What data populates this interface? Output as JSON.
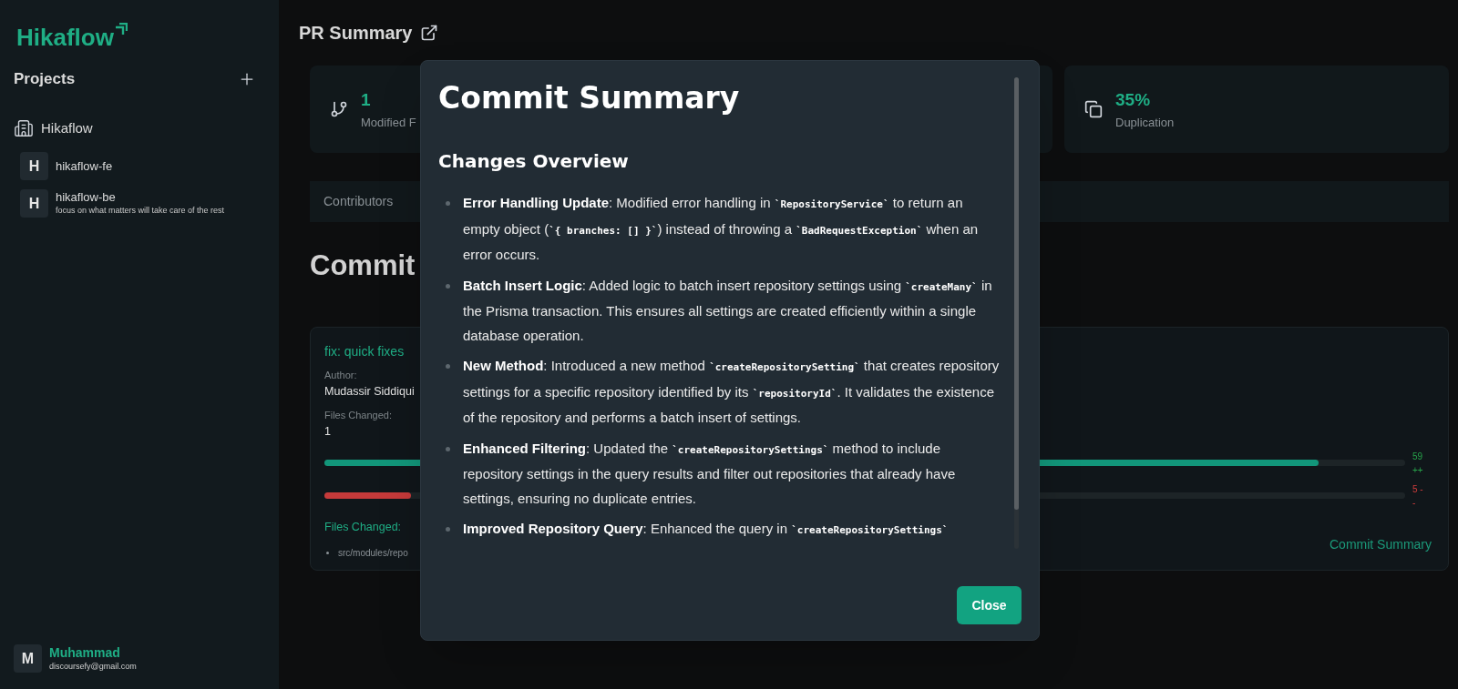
{
  "sidebar": {
    "logo": "Hikaflow",
    "projects_title": "Projects",
    "group": {
      "name": "Hikaflow",
      "repos": [
        {
          "avatar": "H",
          "name": "hikaflow-fe"
        },
        {
          "avatar": "H",
          "name": "hikaflow-be",
          "description": "focus on what matters will take care of the rest"
        }
      ]
    },
    "user": {
      "avatar": "M",
      "name": "Muhammad",
      "email": "discoursefy@gmail.com"
    }
  },
  "main": {
    "title": "PR Summary",
    "stats": [
      {
        "kind": "branch",
        "value": "1",
        "label": "Modified F"
      },
      {
        "kind": "copy",
        "value": "35%",
        "label": "Duplication"
      }
    ],
    "tabs": [
      {
        "label": "Contributors"
      }
    ],
    "section_heading": "Commit",
    "commit": {
      "title": "fix: quick fixes",
      "author_label": "Author:",
      "author": "Mudassir Siddiqui",
      "files_label": "Files Changed:",
      "files_count": "1",
      "changes": [
        {
          "kind": "additions",
          "level": 0.92,
          "reading": [
            "59",
            "++"
          ]
        },
        {
          "kind": "deletions",
          "level": 0.08,
          "reading": [
            "5 -",
            "-"
          ]
        }
      ],
      "files_heading": "Files Changed:",
      "files": [
        "src/modules/repo"
      ],
      "link": "Commit Summary"
    }
  },
  "modal": {
    "title": "Commit Summary",
    "heading": "Changes Overview",
    "items": [
      [
        {
          "kind": "bold",
          "text": "Error Handling Update"
        },
        {
          "kind": "text",
          "text": ": Modified error handling in "
        },
        {
          "kind": "code",
          "text": "`RepositoryService`"
        },
        {
          "kind": "text",
          "text": " to return an empty object ("
        },
        {
          "kind": "code",
          "text": "`{ branches: [] }`"
        },
        {
          "kind": "text",
          "text": ") instead of throwing a "
        },
        {
          "kind": "code",
          "text": "`BadRequestException`"
        },
        {
          "kind": "text",
          "text": " when an error occurs."
        }
      ],
      [
        {
          "kind": "bold",
          "text": "Batch Insert Logic"
        },
        {
          "kind": "text",
          "text": ": Added logic to batch insert repository settings using "
        },
        {
          "kind": "code",
          "text": "`createMany`"
        },
        {
          "kind": "text",
          "text": " in the Prisma transaction. This ensures all settings are created efficiently within a single database operation."
        }
      ],
      [
        {
          "kind": "bold",
          "text": "New Method"
        },
        {
          "kind": "text",
          "text": ": Introduced a new method "
        },
        {
          "kind": "code",
          "text": "`createRepositorySetting`"
        },
        {
          "kind": "text",
          "text": " that creates repository settings for a specific repository identified by its "
        },
        {
          "kind": "code",
          "text": "`repositoryId`"
        },
        {
          "kind": "text",
          "text": ". It validates the existence of the repository and performs a batch insert of settings."
        }
      ],
      [
        {
          "kind": "bold",
          "text": "Enhanced Filtering"
        },
        {
          "kind": "text",
          "text": ": Updated the "
        },
        {
          "kind": "code",
          "text": "`createRepositorySettings`"
        },
        {
          "kind": "text",
          "text": " method to include repository settings in the query results and filter out repositories that already have settings, ensuring no duplicate entries."
        }
      ],
      [
        {
          "kind": "bold",
          "text": "Improved Repository Query"
        },
        {
          "kind": "text",
          "text": ": Enhanced the query in "
        },
        {
          "kind": "code",
          "text": "`createRepositorySettings`"
        }
      ]
    ],
    "close": "Close"
  }
}
